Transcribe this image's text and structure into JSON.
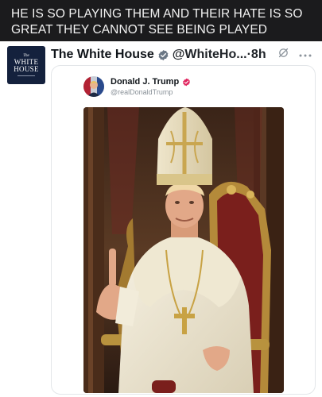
{
  "caption": {
    "text": "HE IS SO PLAYING THEM AND THEIR HATE IS SO GREAT THEY CANNOT SEE BEING PLAYED"
  },
  "post": {
    "avatar": {
      "line1": "The",
      "line2": "WHITE",
      "line3": "HOUSE"
    },
    "author_name": "The White House",
    "handle": "@WhiteHo...",
    "separator": "·",
    "time": "8h",
    "verified_color": "#6b7785",
    "icons": [
      "grok-icon",
      "more-icon"
    ]
  },
  "quoted_post": {
    "author_name": "Donald J. Trump",
    "handle": "@realDonaldTrump",
    "badge_color": "#e0245e",
    "image": "pope-portrait"
  },
  "colors": {
    "caption_bg": "#1b1b1d",
    "card_bg": "#ffffff",
    "avatar_bg": "#14213d"
  }
}
